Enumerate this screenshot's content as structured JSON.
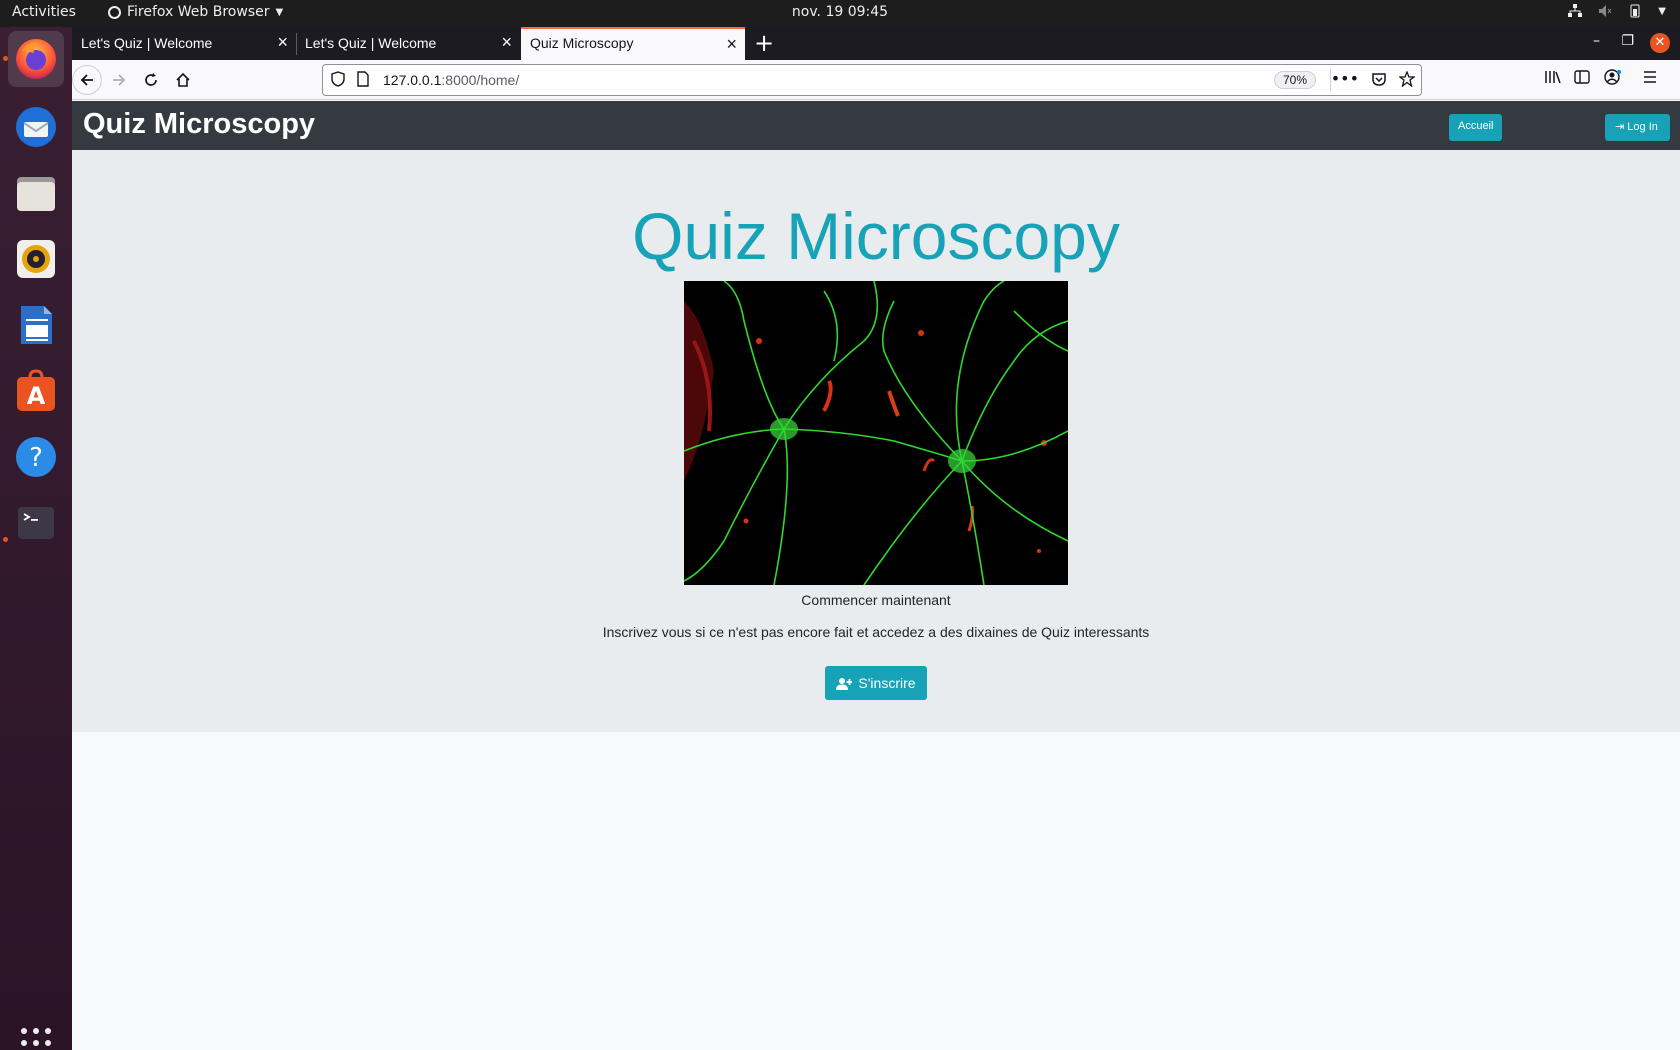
{
  "topbar": {
    "activities": "Activities",
    "app_name": "Firefox Web Browser",
    "clock": "nov. 19  09:45"
  },
  "dock": {
    "items": [
      "firefox",
      "thunderbird",
      "files",
      "rhythmbox",
      "libreoffice-writer",
      "ubuntu-software",
      "help",
      "terminal"
    ]
  },
  "browser": {
    "tabs": [
      {
        "title": "Let's Quiz | Welcome",
        "close": "×"
      },
      {
        "title": "Let's Quiz | Welcome",
        "close": "×"
      },
      {
        "title": "Quiz Microscopy",
        "close": "×"
      }
    ],
    "new_tab": "+",
    "url_host": "127.0.0.1",
    "url_rest": ":8000/home/",
    "zoom": "70%"
  },
  "site": {
    "brand": "Quiz Microscopy",
    "nav": {
      "home": "Accueil",
      "login": "Log In"
    },
    "hero_title": "Quiz Microscopy",
    "caption": "Commencer maintenant",
    "lead": "Inscrivez vous si ce n'est pas encore fait et accedez a des dixaines de Quiz interessants",
    "signup": "S'inscrire"
  },
  "colors": {
    "accent": "#17a2b8",
    "navbar": "#343a40",
    "jumbotron": "#e9ecef",
    "tab_highlight": "#ff6a3a",
    "ubuntu_orange": "#e95420"
  }
}
